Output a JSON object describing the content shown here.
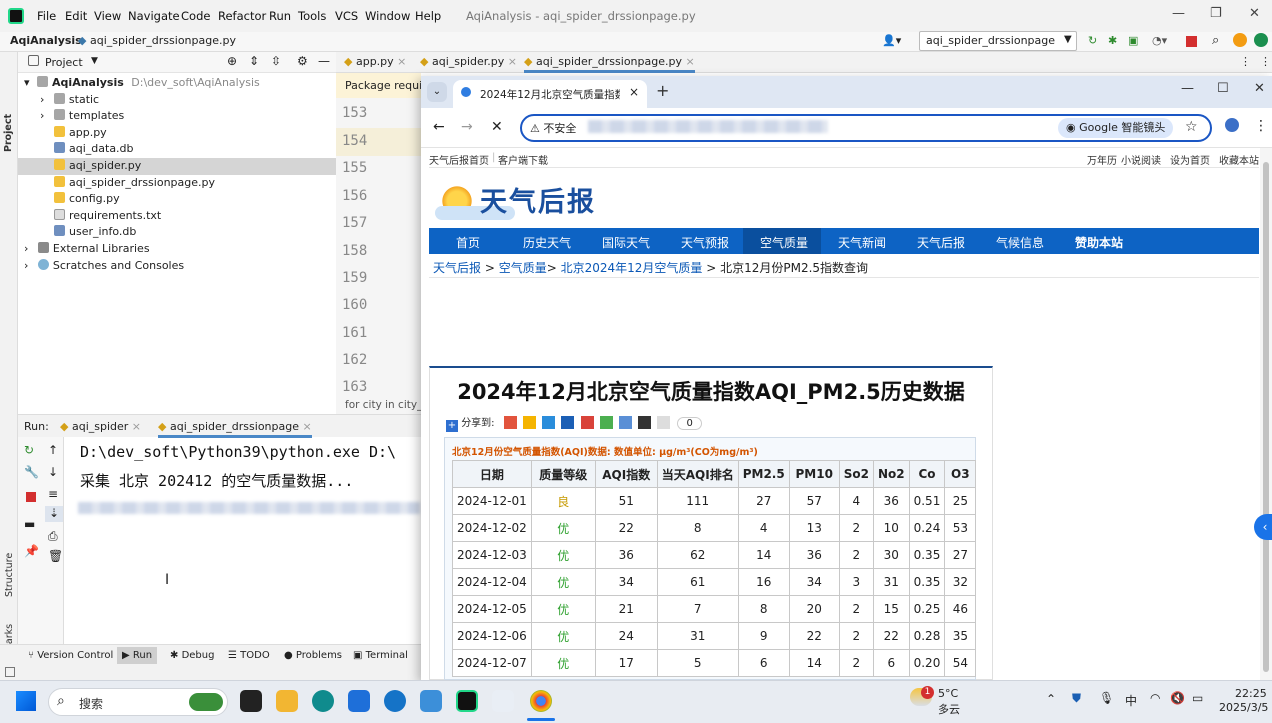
{
  "ide": {
    "menu": [
      "File",
      "Edit",
      "View",
      "Navigate",
      "Code",
      "Refactor",
      "Run",
      "Tools",
      "VCS",
      "Window",
      "Help"
    ],
    "window_title": "AqiAnalysis - aqi_spider_drssionpage.py",
    "breadcrumb_project": "AqiAnalysis",
    "breadcrumb_file": "aqi_spider_drssionpage.py",
    "run_config": "aqi_spider_drssionpage",
    "project_label": "Project",
    "left_strip": {
      "project": "Project",
      "structure": "Structure",
      "bookmarks": "Bookmarks"
    },
    "tree": [
      {
        "label": "AqiAnalysis",
        "path": "D:\\dev_soft\\AqiAnalysis"
      },
      {
        "label": "static"
      },
      {
        "label": "templates"
      },
      {
        "label": "app.py"
      },
      {
        "label": "aqi_data.db"
      },
      {
        "label": "aqi_spider.py"
      },
      {
        "label": "aqi_spider_drssionpage.py"
      },
      {
        "label": "config.py"
      },
      {
        "label": "requirements.txt"
      },
      {
        "label": "user_info.db"
      },
      {
        "label": "External Libraries"
      },
      {
        "label": "Scratches and Consoles"
      }
    ],
    "editor_tabs": [
      "app.py",
      "aqi_spider.py",
      "aqi_spider_drssionpage.py"
    ],
    "package_banner": "Package require",
    "line_numbers": [
      "153",
      "154",
      "155",
      "156",
      "157",
      "158",
      "159",
      "160",
      "161",
      "162",
      "163"
    ],
    "code_snippet": "for city in city_n",
    "run_label": "Run:",
    "run_tabs": [
      "aqi_spider",
      "aqi_spider_drssionpage"
    ],
    "console": [
      "D:\\dev_soft\\Python39\\python.exe D:\\",
      "采集 北京 202412 的空气质量数据..."
    ],
    "status_tabs": [
      "Version Control",
      "Run",
      "Debug",
      "TODO",
      "Problems",
      "Terminal"
    ]
  },
  "browser": {
    "tab_title": "2024年12月北京空气质量指数",
    "security_label": "不安全",
    "lens_label": "Google 智能镜头",
    "top_links_left": [
      "天气后报首页",
      "客户端下载"
    ],
    "top_links_right": [
      "万年历",
      "小说阅读",
      "设为首页",
      "收藏本站"
    ],
    "logo_text": "天气后报",
    "nav": [
      "首页",
      "历史天气",
      "国际天气",
      "天气预报",
      "空气质量",
      "天气新闻",
      "天气后报",
      "气候信息",
      "赞助本站"
    ],
    "breadcrumb": [
      "天气后报",
      "空气质量",
      "北京2024年12月空气质量"
    ],
    "breadcrumb_current": "北京12月份PM2.5指数查询",
    "page_title": "2024年12月北京空气质量指数AQI_PM2.5历史数据",
    "share_label": "分享到:",
    "share_count": "0",
    "table_caption": "北京12月份空气质量指数(AQI)数据:   数值单位: μg/m³(CO为mg/m³)",
    "table_headers": [
      "日期",
      "质量等级",
      "AQI指数",
      "当天AQI排名",
      "PM2.5",
      "PM10",
      "So2",
      "No2",
      "Co",
      "O3"
    ],
    "table_rows": [
      [
        "2024-12-01",
        "良",
        "51",
        "111",
        "27",
        "57",
        "4",
        "36",
        "0.51",
        "25"
      ],
      [
        "2024-12-02",
        "优",
        "22",
        "8",
        "4",
        "13",
        "2",
        "10",
        "0.24",
        "53"
      ],
      [
        "2024-12-03",
        "优",
        "36",
        "62",
        "14",
        "36",
        "2",
        "30",
        "0.35",
        "27"
      ],
      [
        "2024-12-04",
        "优",
        "34",
        "61",
        "16",
        "34",
        "3",
        "31",
        "0.35",
        "32"
      ],
      [
        "2024-12-05",
        "优",
        "21",
        "7",
        "8",
        "20",
        "2",
        "15",
        "0.25",
        "46"
      ],
      [
        "2024-12-06",
        "优",
        "24",
        "31",
        "9",
        "22",
        "2",
        "22",
        "0.28",
        "35"
      ],
      [
        "2024-12-07",
        "优",
        "17",
        "5",
        "6",
        "14",
        "2",
        "6",
        "0.20",
        "54"
      ]
    ]
  },
  "taskbar": {
    "search_placeholder": "搜索",
    "weather_temp": "5°C",
    "weather_desc": "多云",
    "weather_badge": "1",
    "ime": "中",
    "time": "22:25",
    "date": "2025/3/5"
  }
}
